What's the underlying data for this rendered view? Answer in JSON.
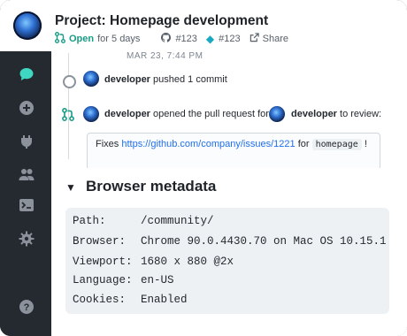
{
  "header": {
    "title": "Project: Homepage development",
    "status": "Open",
    "duration": "for 5 days",
    "ref1": "#123",
    "ref2": "#123",
    "share": "Share"
  },
  "sidebar": {
    "items": [
      {
        "name": "chat",
        "active": true
      },
      {
        "name": "add"
      },
      {
        "name": "plug"
      },
      {
        "name": "users"
      },
      {
        "name": "terminal"
      },
      {
        "name": "settings"
      },
      {
        "name": "help"
      }
    ]
  },
  "timeline": {
    "date": "MAR 23, 7:44 PM",
    "event1": {
      "user": "developer",
      "action": "pushed 1 commit"
    },
    "event2": {
      "user": "developer",
      "action": "opened the pull request for",
      "reviewer": "developer",
      "tail": "to review:"
    },
    "comment": {
      "prefix": "Fixes",
      "link": "https://github.com/company/issues/1221",
      "middle": "for",
      "code": "homepage",
      "suffix": "!"
    }
  },
  "browser_metadata": {
    "title": "Browser metadata",
    "rows": [
      {
        "key": "Path:",
        "value": "/community/"
      },
      {
        "key": "Browser:",
        "value": "Chrome 90.0.4430.70 on Mac OS 10.15.1"
      },
      {
        "key": "Viewport:",
        "value": "1680 x 880 @2x"
      },
      {
        "key": "Language:",
        "value": "en-US"
      },
      {
        "key": "Cookies:",
        "value": "Enabled"
      }
    ]
  },
  "colors": {
    "accent": "#1a9c86",
    "sidebar": "#252a31",
    "link": "#1f6feb"
  }
}
